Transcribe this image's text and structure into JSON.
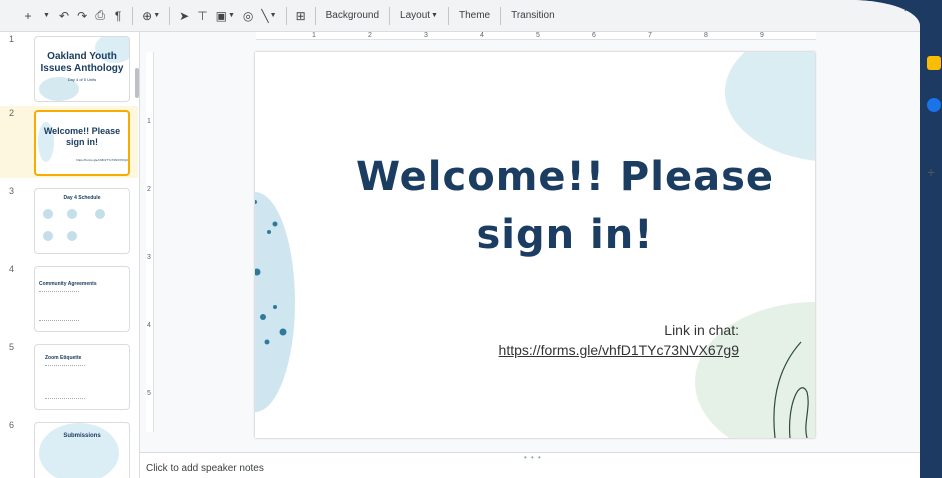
{
  "toolbar": {
    "new_slide_icon": "plus-icon",
    "background_label": "Background",
    "layout_label": "Layout",
    "theme_label": "Theme",
    "transition_label": "Transition"
  },
  "filmstrip": {
    "slides": [
      {
        "number": "1",
        "title": "Oakland Youth Issues Anthology",
        "subtitle": "Day 4 of 5 Units"
      },
      {
        "number": "2",
        "title": "Welcome!! Please sign in!",
        "subtitle": "https://forms.gle/vhfD1TYc73NVX67g9"
      },
      {
        "number": "3",
        "title": "Day 4 Schedule",
        "subtitle": ""
      },
      {
        "number": "4",
        "title": "Community Agreements",
        "subtitle": ""
      },
      {
        "number": "5",
        "title": "Zoom Etiquette",
        "subtitle": ""
      },
      {
        "number": "6",
        "title": "Submissions",
        "subtitle": ""
      }
    ]
  },
  "ruler": {
    "top_numbers": [
      "1",
      "2",
      "3",
      "4",
      "5",
      "6",
      "7",
      "8",
      "9"
    ],
    "left_numbers": [
      "1",
      "2",
      "3",
      "4",
      "5"
    ]
  },
  "slide": {
    "title_line1": "Welcome!! Please",
    "title_line2": "sign in!",
    "link_label": "Link in chat:",
    "link_url": "https://forms.gle/vhfD1TYc73NVX67g9"
  },
  "notes": {
    "placeholder": "Click to add speaker notes"
  },
  "colors": {
    "title": "#1b3d62",
    "selected_border": "#f9ab00",
    "frame_bg": "#1d3a63",
    "keep_icon": "#fbbc04",
    "tasks_icon": "#1a73e8"
  }
}
